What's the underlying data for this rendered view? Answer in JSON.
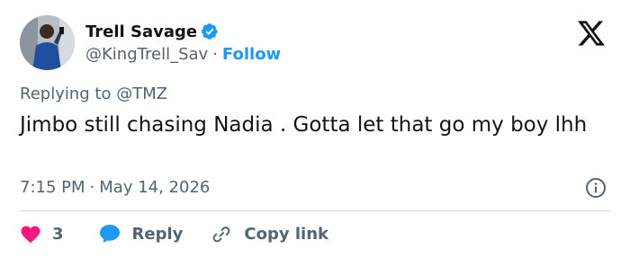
{
  "author": {
    "display_name": "Trell Savage",
    "handle": "@KingTrell_Sav",
    "separator": "·",
    "follow_label": "Follow",
    "verified_icon": "verified-badge-icon"
  },
  "brand": {
    "logo_icon": "x-logo-icon"
  },
  "reply_context": {
    "text": "Replying to @TMZ"
  },
  "tweet": {
    "text": "Jimbo still chasing Nadia . Gotta let that go my boy lhh",
    "time": "7:15 PM",
    "separator": "·",
    "date": "May 14, 2026"
  },
  "actions": {
    "like_count": "3",
    "reply_label": "Reply",
    "copy_label": "Copy link"
  },
  "colors": {
    "accent": "#1d9bf0",
    "like": "#f91880",
    "text": "#0f1419",
    "muted": "#536471",
    "divider": "#cfd9de"
  }
}
